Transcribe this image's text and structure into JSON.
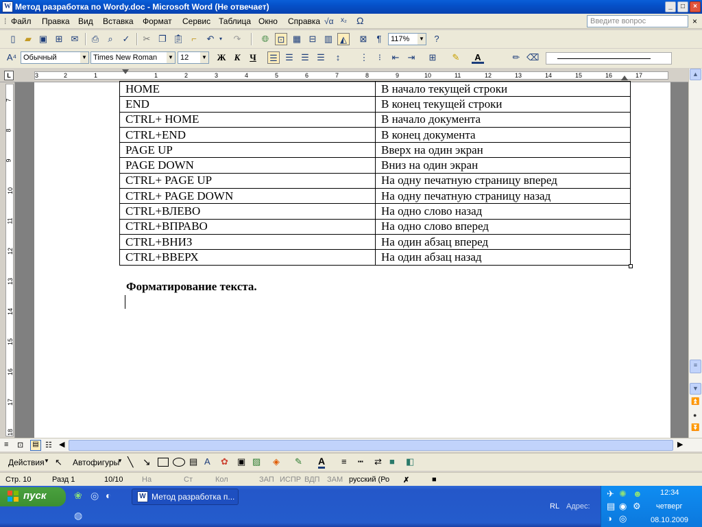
{
  "window": {
    "title": "Метод разработка по Wordy.doc - Microsoft Word (Не отвечает)",
    "app_icon": "W"
  },
  "menu": [
    "Файл",
    "Правка",
    "Вид",
    "Вставка",
    "Формат",
    "Сервис",
    "Таблица",
    "Окно",
    "Справка"
  ],
  "help_placeholder": "Введите вопрос",
  "toolbar": {
    "zoom": "117%",
    "style": "Обычный",
    "font": "Times New Roman",
    "size": "12"
  },
  "ruler_h": [
    "3",
    "2",
    "1",
    "1",
    "2",
    "3",
    "4",
    "5",
    "6",
    "7",
    "8",
    "9",
    "10",
    "11",
    "12",
    "13",
    "14",
    "15",
    "16",
    "17"
  ],
  "ruler_v": [
    "7",
    "8",
    "9",
    "10",
    "11",
    "12",
    "13",
    "14",
    "15",
    "16",
    "17",
    "18"
  ],
  "table": [
    [
      "HOME",
      "В начало текущей строки"
    ],
    [
      "END",
      "В конец текущей строки"
    ],
    [
      "CTRL+ HOME",
      "В начало документа"
    ],
    [
      "CTRL+END",
      "В конец документа"
    ],
    [
      "PAGE UP",
      "Вверх на один экран"
    ],
    [
      "PAGE DOWN",
      "Вниз на один экран"
    ],
    [
      "CTRL+ PAGE UP",
      "На одну печатную страницу вперед"
    ],
    [
      "CTRL+ PAGE DOWN",
      "На одну печатную страницу назад"
    ],
    [
      "CTRL+ВЛЕВО",
      "На одно слово назад"
    ],
    [
      "CTRL+ВПРАВО",
      "На одно слово вперед"
    ],
    [
      "CTRL+ВНИЗ",
      "На один абзац вперед"
    ],
    [
      "CTRL+ВВЕРХ",
      "На один абзац назад"
    ]
  ],
  "heading": "Форматирование текста.",
  "drawbar": {
    "actions": "Действия",
    "autoshapes": "Автофигуры"
  },
  "status": {
    "page": "Стр. 10",
    "section": "Разд 1",
    "pages": "10/10",
    "at": "На",
    "line": "Ст",
    "col": "Кол",
    "rec": "ЗАП",
    "trk": "ИСПР",
    "ext": "ВДП",
    "ovr": "ЗАМ",
    "lang": "русский (Ро"
  },
  "taskbar": {
    "start": "пуск",
    "task": "Метод разработка п...",
    "lang": "RL",
    "address": "Адрес:",
    "time": "12:34",
    "weekday": "четверг",
    "date": "08.10.2009"
  },
  "colors": {
    "titlebar": "#0a5fd8",
    "taskbar": "#245ccc",
    "start": "#3c8f31",
    "tray": "#0f8df2"
  }
}
